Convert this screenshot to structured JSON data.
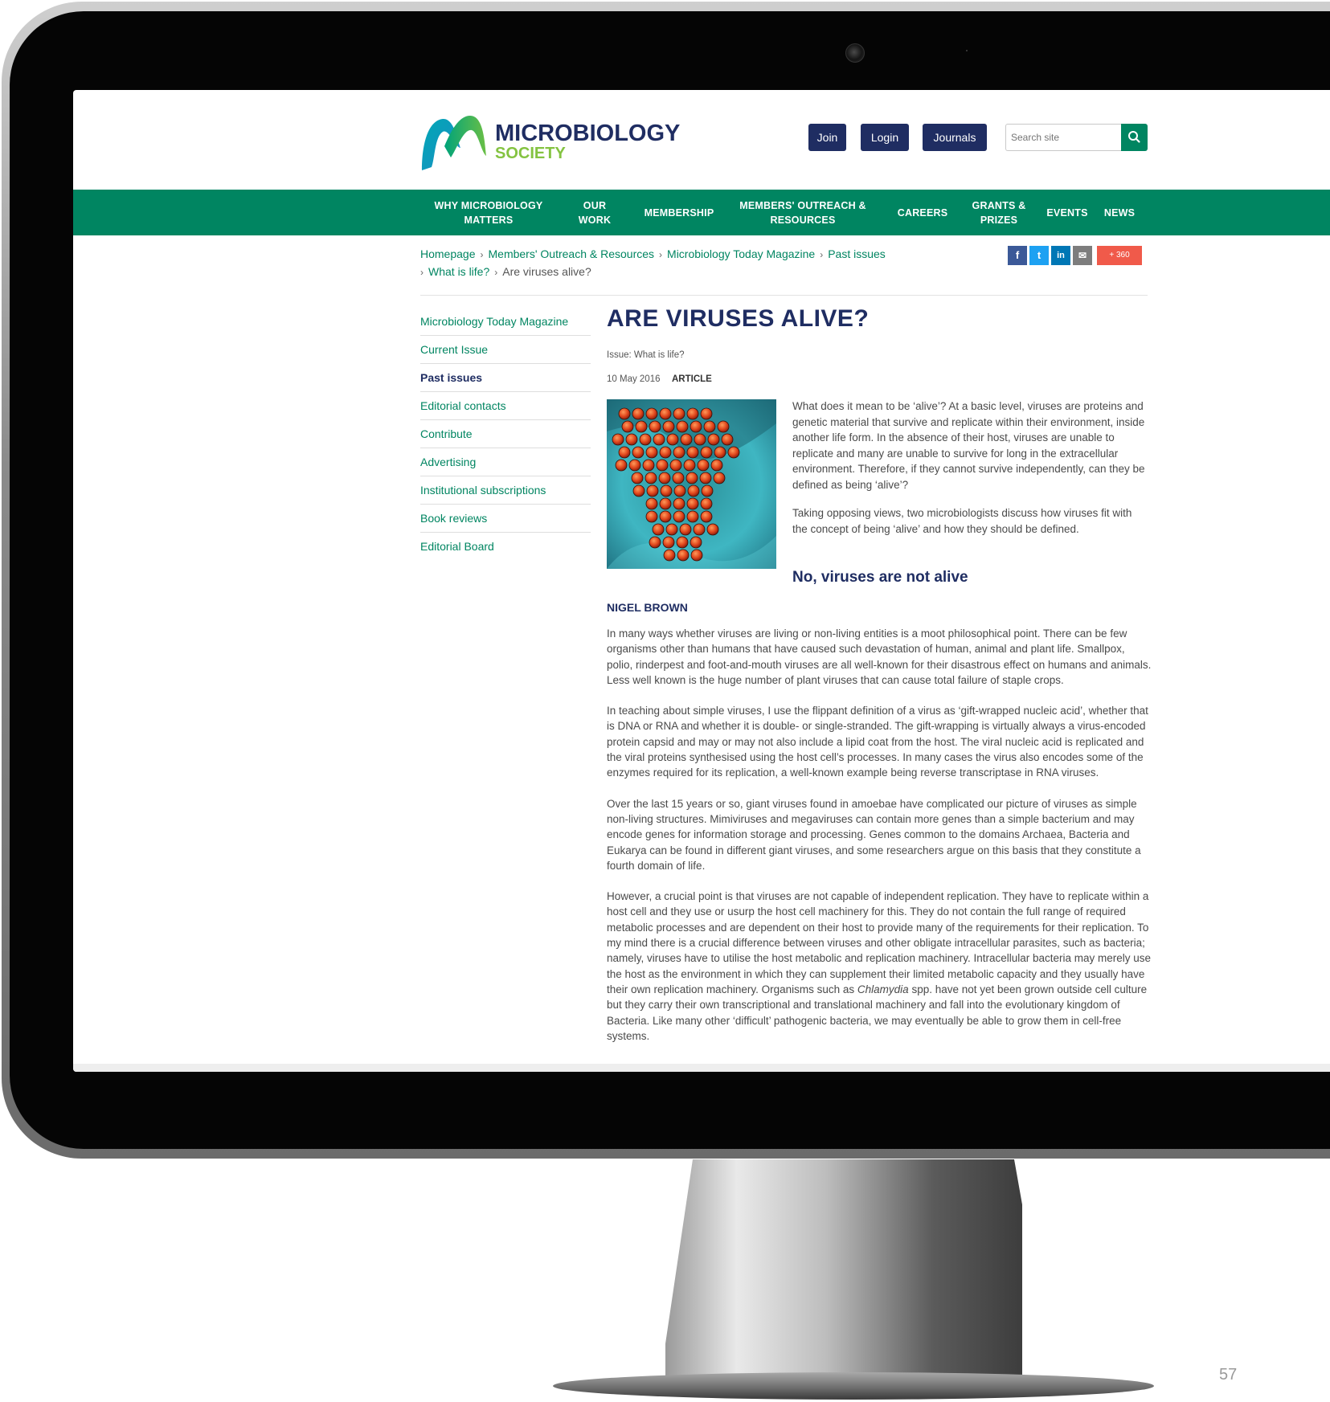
{
  "header": {
    "logo_title": "MICROBIOLOGY",
    "logo_subtitle": "SOCIETY",
    "join_label": "Join",
    "login_label": "Login",
    "journals_label": "Journals",
    "search_placeholder": "Search site"
  },
  "nav": {
    "items": [
      {
        "label": "WHY MICROBIOLOGY MATTERS"
      },
      {
        "label": "OUR WORK"
      },
      {
        "label": "MEMBERSHIP"
      },
      {
        "label": "MEMBERS' OUTREACH & RESOURCES"
      },
      {
        "label": "CAREERS"
      },
      {
        "label": "GRANTS & PRIZES"
      },
      {
        "label": "EVENTS"
      },
      {
        "label": "NEWS"
      }
    ]
  },
  "breadcrumb": {
    "items": [
      "Homepage",
      "Members' Outreach & Resources",
      "Microbiology Today Magazine",
      "Past issues",
      "What is life?"
    ],
    "current": "Are viruses alive?",
    "separator": "›"
  },
  "share": {
    "facebook": "f",
    "twitter": "t",
    "linkedin": "in",
    "email": "✉",
    "count_label": "+ 360"
  },
  "sidebar": {
    "items": [
      {
        "label": "Microbiology Today Magazine"
      },
      {
        "label": "Current Issue"
      },
      {
        "label": "Past issues"
      },
      {
        "label": "Editorial contacts"
      },
      {
        "label": "Contribute"
      },
      {
        "label": "Advertising"
      },
      {
        "label": "Institutional subscriptions"
      },
      {
        "label": "Book reviews"
      },
      {
        "label": "Editorial Board"
      }
    ],
    "active_index": 2
  },
  "article": {
    "title": "ARE VIRUSES ALIVE?",
    "issue": "Issue: What is life?",
    "date": "10 May 2016",
    "type": "ARTICLE",
    "intro": [
      "What does it mean to be ‘alive’? At a basic level, viruses are proteins and genetic material that survive and replicate within their environment, inside another life form. In the absence of their host, viruses are unable to replicate and many are unable to survive for long in the extracellular environment. Therefore, if they cannot survive independently, can they be defined as being ‘alive’?",
      "Taking opposing views, two microbiologists discuss how viruses fit with the concept of being ‘alive’ and how they should be defined."
    ],
    "subheading": "No, viruses are not alive",
    "author": "NIGEL BROWN",
    "paragraphs": [
      "In many ways whether viruses are living or non-living entities is a moot philosophical point. There can be few organisms other than humans that have caused such devastation of human, animal and plant life. Smallpox, polio, rinderpest and foot-and-mouth viruses are all well-known for their disastrous effect on humans and animals. Less well known is the huge number of plant viruses that can cause total failure of staple crops.",
      "In teaching about simple viruses, I use the flippant definition of a virus as ‘gift-wrapped nucleic acid’, whether that is DNA or RNA and whether it is double- or single-stranded. The gift-wrapping is virtually always a virus-encoded protein capsid and may or may not also include a lipid coat from the host. The viral nucleic acid is replicated and the viral proteins synthesised using the host cell’s processes. In many cases the virus also encodes some of the enzymes required for its replication, a well-known example being reverse transcriptase in RNA viruses.",
      "Over the last 15 years or so, giant viruses found in amoebae have complicated our picture of viruses as simple non-living structures. Mimiviruses and megaviruses can contain more genes than a simple bacterium and may encode genes for information storage and processing. Genes common to the domains Archaea, Bacteria and Eukarya can be found in different giant viruses, and some researchers argue on this basis that they constitute a fourth domain of life."
    ],
    "last_paragraph_before": "However, a crucial point is that viruses are not capable of independent replication. They have to replicate within a host cell and they use or usurp the host cell machinery for this. They do not contain the full range of required metabolic processes and are dependent on their host to provide many of the requirements for their replication. To my mind there is a crucial difference between viruses and other obligate intracellular parasites, such as bacteria; namely, viruses have to utilise the host metabolic and replication machinery. Intracellular bacteria may merely use the host as the environment in which they can supplement their limited metabolic capacity and they usually have their own replication machinery. Organisms such as",
    "last_paragraph_italic": "Chlamydia",
    "last_paragraph_after": "spp. have not yet been grown outside cell culture but they carry their own transcriptional and translational machinery and fall into the evolutionary kingdom of Bacteria. Like many other ‘difficult’ pathogenic bacteria, we may eventually be able to grow them in cell-free systems."
  },
  "page_number": "57",
  "colors": {
    "brand_green": "#008561",
    "brand_navy": "#1f2d62",
    "logo_lime": "#84c341",
    "share_facebook": "#3b5998",
    "share_twitter": "#1da1f2",
    "share_linkedin": "#0077b5",
    "share_email": "#7d7d7d",
    "share_count": "#f05a4a"
  }
}
